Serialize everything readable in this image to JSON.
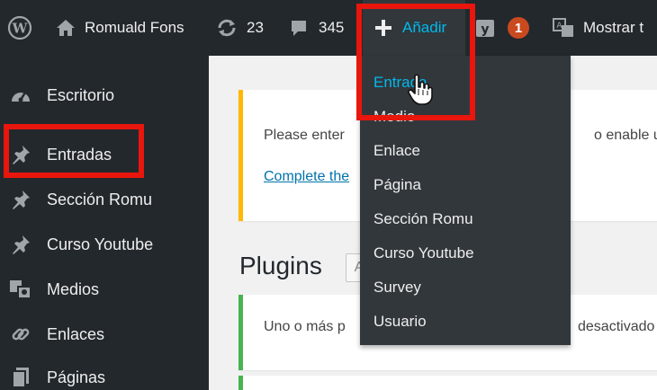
{
  "adminbar": {
    "site_name": "Romuald Fons",
    "updates_count": "23",
    "comments_count": "345",
    "add_new_label": "Añadir",
    "notification_count": "1",
    "translate_label": "Mostrar t"
  },
  "sidebar": {
    "items": [
      {
        "label": "Escritorio",
        "icon": "dashboard-icon"
      },
      {
        "label": "Entradas",
        "icon": "pin-icon"
      },
      {
        "label": "Sección Romu",
        "icon": "pin-icon"
      },
      {
        "label": "Curso Youtube",
        "icon": "pin-icon"
      },
      {
        "label": "Medios",
        "icon": "media-icon"
      },
      {
        "label": "Enlaces",
        "icon": "link-icon"
      },
      {
        "label": "Páginas",
        "icon": "page-icon"
      }
    ]
  },
  "main": {
    "notice1_text_left": "Please enter",
    "notice1_text_right": "o enable up",
    "notice1_link": "Complete the",
    "page_title": "Plugins",
    "title_box_text": "A",
    "notice2_text_left": "Uno o más p",
    "notice2_text_right": "desactivado"
  },
  "dropdown": {
    "items": [
      "Entrada",
      "Medio",
      "Enlace",
      "Página",
      "Sección Romu",
      "Curso Youtube",
      "Survey",
      "Usuario"
    ]
  },
  "colors": {
    "adminbar_bg": "#23282d",
    "dropdown_bg": "#32373c",
    "accent_blue": "#00b9eb",
    "highlight_red": "#e8160c",
    "notice_warning": "#ffb900",
    "notice_success": "#46b450",
    "notification_badge": "#ca4a1f"
  }
}
